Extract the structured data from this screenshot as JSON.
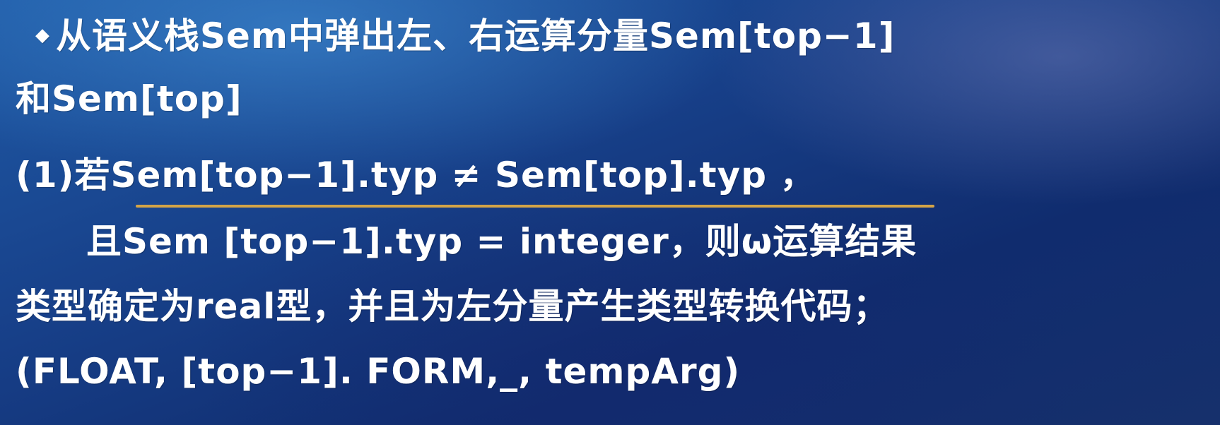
{
  "lines": {
    "bullet": "◆",
    "line1": "从语义栈Sem中弹出左、右运算分量Sem[top−1]",
    "line2": "和Sem[top]",
    "line3_prefix": "(1)若",
    "line3_condition": "Sem[top−1].typ ≠ Sem[top].typ",
    "line3_suffix": " ，",
    "line4": "且Sem [top−1].typ = integer，则ω运算结果",
    "line5": "类型确定为real型，并且为左分量产生类型转换代码；",
    "line6": "(FLOAT, [top−1]. FORM,_, tempArg)"
  },
  "colors": {
    "text": "#ffffff",
    "underline": "#d4a447",
    "background": "#173f88"
  }
}
